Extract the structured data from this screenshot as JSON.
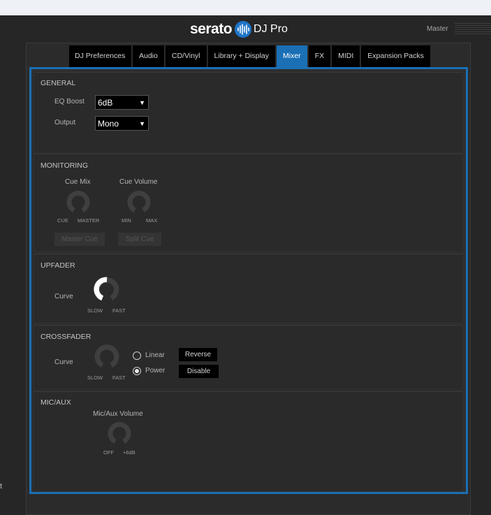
{
  "header": {
    "brand_word": "serato",
    "product": "DJ Pro",
    "master_label": "Master",
    "brand_color": "#1e74c6"
  },
  "tabs": [
    {
      "label": "DJ Preferences",
      "active": false
    },
    {
      "label": "Audio",
      "active": false
    },
    {
      "label": "CD/Vinyl",
      "active": false
    },
    {
      "label": "Library + Display",
      "active": false
    },
    {
      "label": "Mixer",
      "active": true
    },
    {
      "label": "FX",
      "active": false
    },
    {
      "label": "MIDI",
      "active": false
    },
    {
      "label": "Expansion Packs",
      "active": false
    }
  ],
  "accent_color": "#1a6fb5",
  "general": {
    "title": "GENERAL",
    "eq_boost_label": "EQ Boost",
    "eq_boost_value": "6dB",
    "output_label": "Output",
    "output_value": "Mono"
  },
  "monitoring": {
    "title": "MONITORING",
    "cue_mix_label": "Cue Mix",
    "cue_mix_min": "CUE",
    "cue_mix_max": "MASTER",
    "cue_volume_label": "Cue Volume",
    "cue_volume_min": "MIN",
    "cue_volume_max": "MAX",
    "master_cue_button": "Master Cue",
    "split_cue_button": "Split Cue"
  },
  "upfader": {
    "title": "UPFADER",
    "curve_label": "Curve",
    "min_label": "SLOW",
    "max_label": "FAST"
  },
  "crossfader": {
    "title": "CROSSFADER",
    "curve_label": "Curve",
    "min_label": "SLOW",
    "max_label": "FAST",
    "linear_label": "Linear",
    "power_label": "Power",
    "selected_mode": "Power",
    "reverse_button": "Reverse",
    "disable_button": "Disable"
  },
  "mic_aux": {
    "title": "MIC/AUX",
    "volume_label": "Mic/Aux Volume",
    "min_label": "OFF",
    "max_label": "+6dB"
  },
  "side_text": "t"
}
